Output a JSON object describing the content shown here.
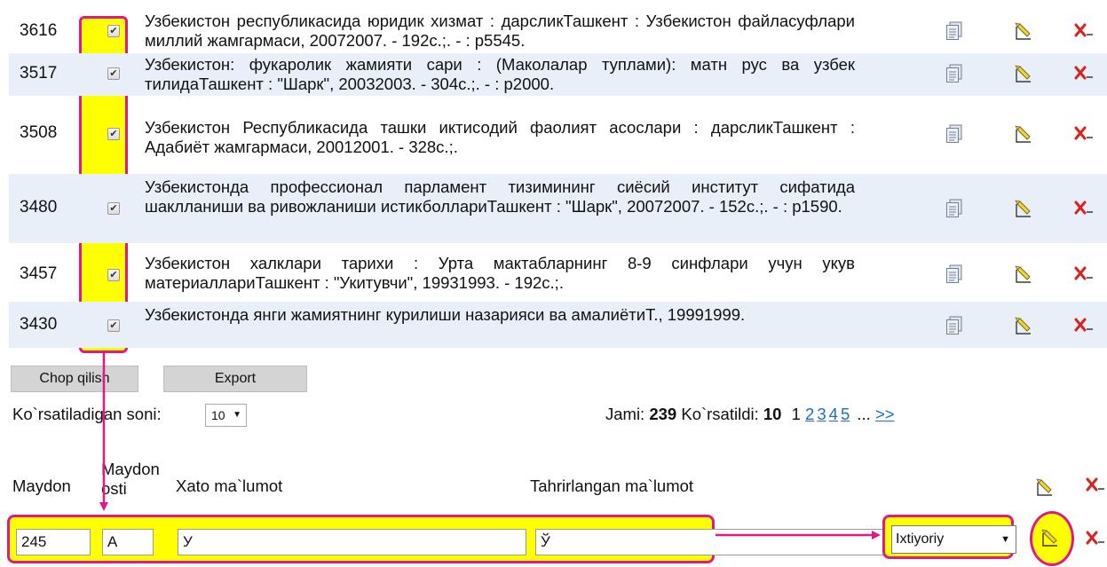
{
  "records": [
    {
      "id": "3616",
      "text": "Узбекистон республикасида юридик хизмат : дарсликТашкент : Узбекистон файласуфлари миллий жамгармаси, 20072007. - 192с.;. - : р5545.",
      "checked": true
    },
    {
      "id": "3517",
      "text": "Узбекистон: фукаролик жамияти сари : (Маколалар туплами): матн рус ва узбек тилидаТашкент : \"Шарк\", 20032003. - 304с.;. - : р2000.",
      "checked": true
    },
    {
      "id": "3508",
      "text": "Узбекистон Республикасида ташки иктисодий фаолият асослари : дарсликТашкент : Адабиёт жамгармаси, 20012001. - 328с.;.",
      "checked": true
    },
    {
      "id": "3480",
      "text": "Узбекистонда профессионал парламент тизимининг сиёсий институт сифатида шаклланиши ва ривожланиши истикболлариТашкент : \"Шарк\", 20072007. - 152с.;. - : р1590.",
      "checked": true
    },
    {
      "id": "3457",
      "text": "Узбекистон халклари тарихи : Урта мактабларнинг 8-9 синфлари учун укув материаллариТашкент : \"Укитувчи\", 19931993. - 192с.;.",
      "checked": true
    },
    {
      "id": "3430",
      "text": "Узбекистонда янги жамиятнинг курилиши назарияси ва амалиётиТ., 19991999.",
      "checked": true
    }
  ],
  "buttons": {
    "print": "Chop qilish",
    "export": "Export"
  },
  "pager": {
    "label": "Ko`rsatiladigan soni:",
    "page_size": "10",
    "total_label": "Jami:",
    "total": "239",
    "shown_label": "Ko`rsatildi:",
    "shown": "10",
    "current_page": "1",
    "pages": [
      "2",
      "3",
      "4",
      "5"
    ],
    "ellipsis": "...",
    "next": ">>"
  },
  "form": {
    "headers": {
      "field": "Maydon",
      "subfield": "Maydon osti",
      "wrong": "Xato ma`lumot",
      "corrected": "Tahrirlangan ma`lumot"
    },
    "values": {
      "field": "245",
      "subfield": "A",
      "wrong": "У",
      "corrected": "Ў",
      "mode": "Ixtiyoriy"
    }
  },
  "colors": {
    "highlight": "#ffff00",
    "annotation": "#e0198a",
    "row_shade": "#e9eff8",
    "link": "#1a6fc2"
  },
  "icons": [
    "copy-icon",
    "edit-pencil-icon",
    "delete-icon"
  ]
}
